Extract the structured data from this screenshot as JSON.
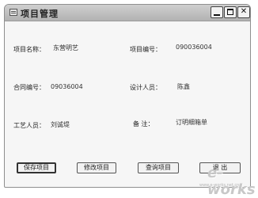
{
  "window": {
    "title": "项目管理",
    "minimize_label": "",
    "maximize_label": "",
    "close_label": "✕"
  },
  "form": {
    "project_name_label": "项目名称：",
    "project_name_value": "东营明艺",
    "project_no_label": "项目编号：",
    "project_no_value": "090036004",
    "contract_no_label": "合同编号：",
    "contract_no_value": "09036004",
    "designer_label": "设计人员：",
    "designer_value": "陈鑫",
    "craftsman_label": "工艺人员：",
    "craftsman_value": "刘诚堤",
    "remark_label": "备 注：",
    "remark_value": "订明细箱单"
  },
  "buttons": {
    "save": "保存项目",
    "modify": "修改项目",
    "query": "查询项目",
    "exit": "退 出"
  },
  "watermark": {
    "brand": "e-works",
    "url": "www.e-works.net.cn"
  }
}
